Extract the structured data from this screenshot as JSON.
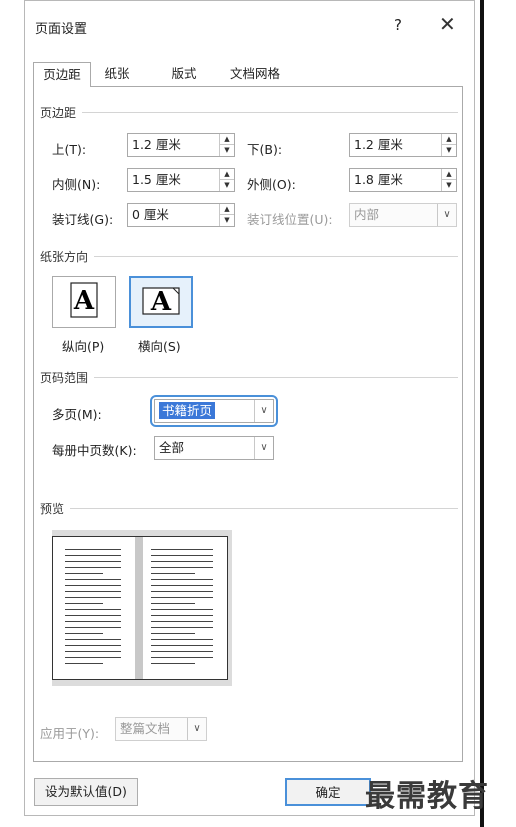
{
  "window": {
    "title": "页面设置",
    "help": "?",
    "close": "✕"
  },
  "tabs": [
    {
      "label": "页边距",
      "active": true
    },
    {
      "label": "纸张",
      "active": false
    },
    {
      "label": "版式",
      "active": false
    },
    {
      "label": "文档网格",
      "active": false
    }
  ],
  "margins": {
    "section": "页边距",
    "top_label": "上(T):",
    "top_value": "1.2 厘米",
    "bottom_label": "下(B):",
    "bottom_value": "1.2 厘米",
    "inside_label": "内侧(N):",
    "inside_value": "1.5 厘米",
    "outside_label": "外侧(O):",
    "outside_value": "1.8 厘米",
    "gutter_label": "装订线(G):",
    "gutter_value": "0 厘米",
    "gutter_pos_label": "装订线位置(U):",
    "gutter_pos_value": "内部"
  },
  "orientation": {
    "section": "纸张方向",
    "portrait_label": "纵向(P)",
    "landscape_label": "横向(S)",
    "glyph": "A"
  },
  "pages": {
    "section": "页码范围",
    "multiple_label": "多页(M):",
    "multiple_value": "书籍折页",
    "sheets_label": "每册中页数(K):",
    "sheets_value": "全部"
  },
  "preview": {
    "section": "预览"
  },
  "apply": {
    "label": "应用于(Y):",
    "value": "整篇文档"
  },
  "buttons": {
    "default_label": "设为默认值(D)",
    "ok_label": "确定"
  },
  "watermark": "最需教育",
  "colors": {
    "accent": "#4a90d9",
    "selection": "#3b78d8"
  }
}
